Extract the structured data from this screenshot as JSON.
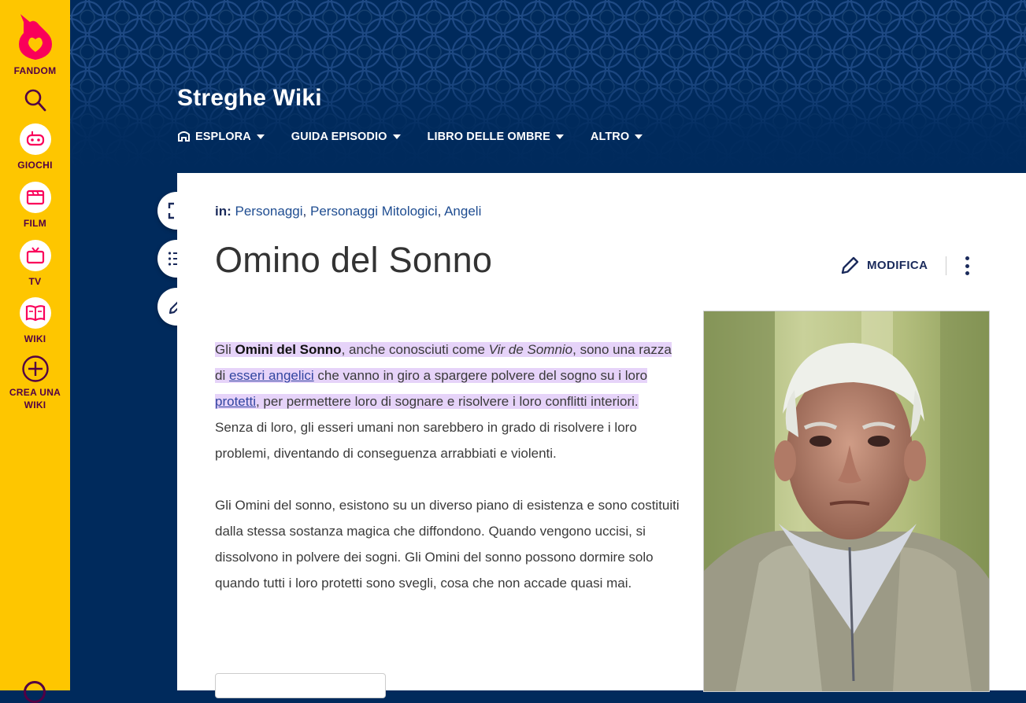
{
  "rail": {
    "brand": "FANDOM",
    "items": [
      {
        "label": "GIOCHI",
        "icon": "controller-icon"
      },
      {
        "label": "FILM",
        "icon": "clapperboard-icon"
      },
      {
        "label": "TV",
        "icon": "tv-icon"
      },
      {
        "label": "WIKI",
        "icon": "book-icon"
      },
      {
        "label": "CREA UNA WIKI",
        "icon": "plus-circle-icon"
      }
    ]
  },
  "header": {
    "wiki_title": "Streghe Wiki",
    "nav": [
      "ESPLORA",
      "GUIDA EPISODIO",
      "LIBRO DELLE OMBRE",
      "ALTRO"
    ]
  },
  "article": {
    "categories_label": "in:",
    "categories": [
      "Personaggi",
      "Personaggi Mitologici",
      "Angeli"
    ],
    "title": "Omino del Sonno",
    "edit_label": "MODIFICA",
    "p1": {
      "t1": "Gli ",
      "bold": "Omini del Sonno",
      "t2": ", anche conosciuti come ",
      "italic": "Vir de Somnio",
      "t3": ", sono una razza di ",
      "link1": "esseri angelici",
      "t4": " che vanno in giro a spargere polvere del sogno su i loro ",
      "link2": "protetti",
      "t5": ", per permettere loro di sognare e risolvere i loro conflitti interiori.",
      "t6": " Senza di loro, gli esseri umani non sarebbero in grado di risolvere i loro problemi, diventando di conseguenza arrabbiati e violenti."
    },
    "p2": "Gli Omini del sonno, esistono su un diverso piano di esistenza e sono costituiti dalla stessa sostanza magica che diffondono. Quando vengono uccisi, si dissolvono in polvere dei sogni. Gli Omini del sonno possono dormire solo quando tutti i loro protetti sono svegli, cosa che non accade quasi mai."
  },
  "colors": {
    "rail": "#fec600",
    "header": "#002a5c",
    "highlight": "#e6d3f9",
    "brand_text": "#520044"
  }
}
